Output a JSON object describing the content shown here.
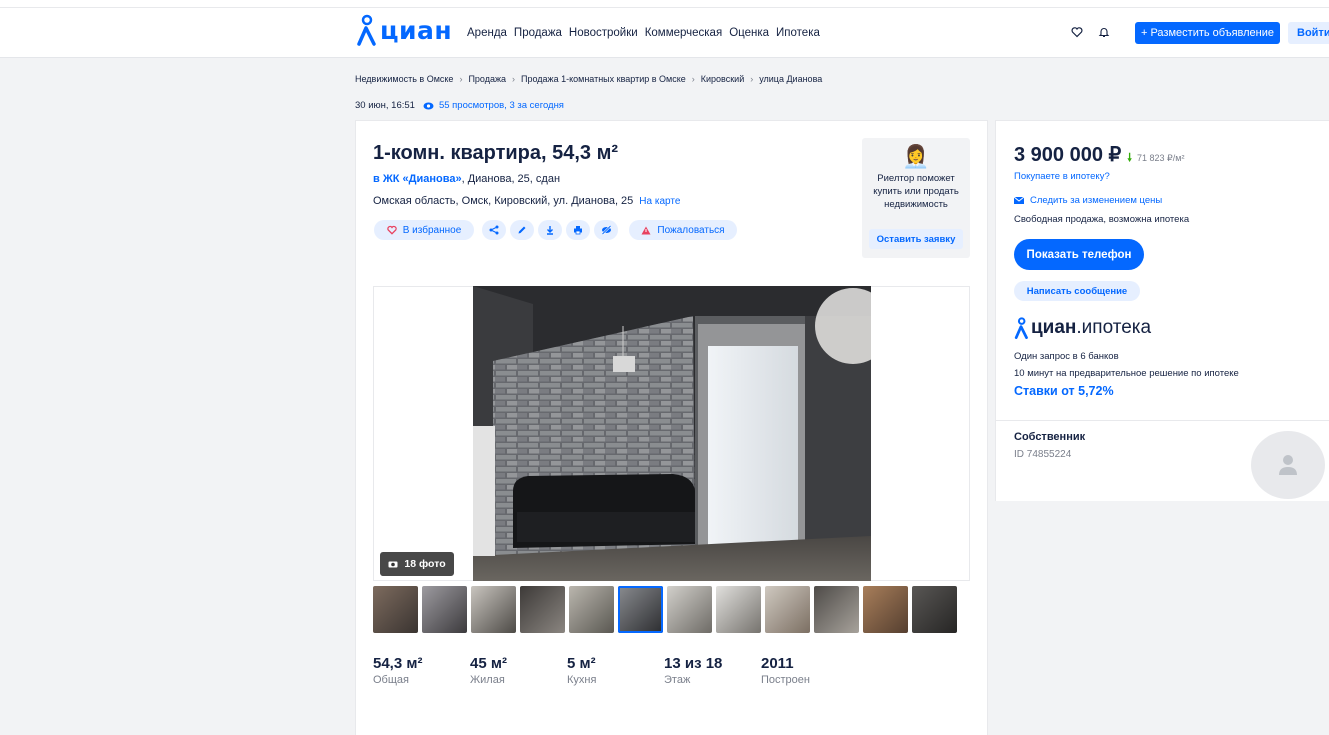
{
  "header": {
    "logo_text": "циан",
    "nav": [
      "Аренда",
      "Продажа",
      "Новостройки",
      "Коммерческая",
      "Оценка",
      "Ипотека"
    ],
    "post_button": "+ Разместить объявление",
    "login_button": "Войти"
  },
  "breadcrumbs": [
    "Недвижимость в Омске",
    "Продажа",
    "Продажа 1-комнатных квартир в Омске",
    "Кировский",
    "улица Дианова"
  ],
  "meta": {
    "date": "30 июн, 16:51",
    "views": "55 просмотров, 3 за сегодня"
  },
  "listing": {
    "title": "1-комн. квартира, 54,3 м²",
    "complex_link": "в ЖК «Дианова»",
    "complex_rest": ", Дианова, 25, сдан",
    "address": "Омская область, Омск, Кировский, ул. Дианова, 25",
    "map_link": "На карте",
    "favorite_label": "В избранное",
    "report_label": "Пожаловаться",
    "photo_count": "18 фото"
  },
  "realtor": {
    "text": "Риелтор поможет купить или продать недвижимость",
    "button": "Оставить заявку"
  },
  "facts": [
    {
      "value": "54,3 м²",
      "label": "Общая"
    },
    {
      "value": "45 м²",
      "label": "Жилая"
    },
    {
      "value": "5 м²",
      "label": "Кухня"
    },
    {
      "value": "13 из 18",
      "label": "Этаж"
    },
    {
      "value": "2011",
      "label": "Построен"
    }
  ],
  "sidebar": {
    "price": "3 900 000 ₽",
    "price_per_sqm": "71 823 ₽/м²",
    "mortgage_link": "Покупаете в ипотеку?",
    "follow_price": "Следить за изменением цены",
    "sale_terms": "Свободная продажа, возможна ипотека",
    "phone_button": "Показать телефон",
    "message_button": "Написать сообщение",
    "ipoteka_logo_bold": "циан",
    "ipoteka_logo_rest": ".ипотека",
    "ipoteka_line1": "Один запрос в 6 банков",
    "ipoteka_line2": "10 минут на предварительное решение по ипотеке",
    "rate": "Ставки от 5,72%",
    "owner_label": "Собственник",
    "owner_id": "ID 74855224"
  },
  "colors": {
    "brand": "#0468ff",
    "text": "#152242",
    "muted": "#7a7f8b",
    "price_down": "#34ac0a"
  }
}
